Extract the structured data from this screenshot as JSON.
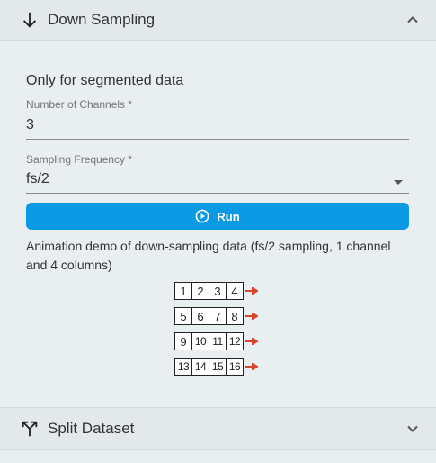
{
  "down_sampling": {
    "title": "Down Sampling",
    "intro": "Only for segmented data",
    "channels": {
      "label": "Number of Channels *",
      "value": "3"
    },
    "frequency": {
      "label": "Sampling Frequency *",
      "value": "fs/2"
    },
    "run_label": "Run",
    "description": "Animation demo of down-sampling data (fs/2 sampling, 1 channel and 4 columns)",
    "demo_rows": [
      [
        "1",
        "2",
        "3",
        "4"
      ],
      [
        "5",
        "6",
        "7",
        "8"
      ],
      [
        "9",
        "10",
        "11",
        "12"
      ],
      [
        "13",
        "14",
        "15",
        "16"
      ]
    ]
  },
  "split_dataset": {
    "title": "Split Dataset"
  },
  "colors": {
    "accent": "#0a9ae4",
    "arrow": "#d9462b"
  },
  "icons": {
    "down_sampling": "arrow-down-icon",
    "split": "call-split-icon",
    "collapse": "chevron-up-icon",
    "expand": "chevron-down-icon",
    "run": "play-circle-icon"
  }
}
